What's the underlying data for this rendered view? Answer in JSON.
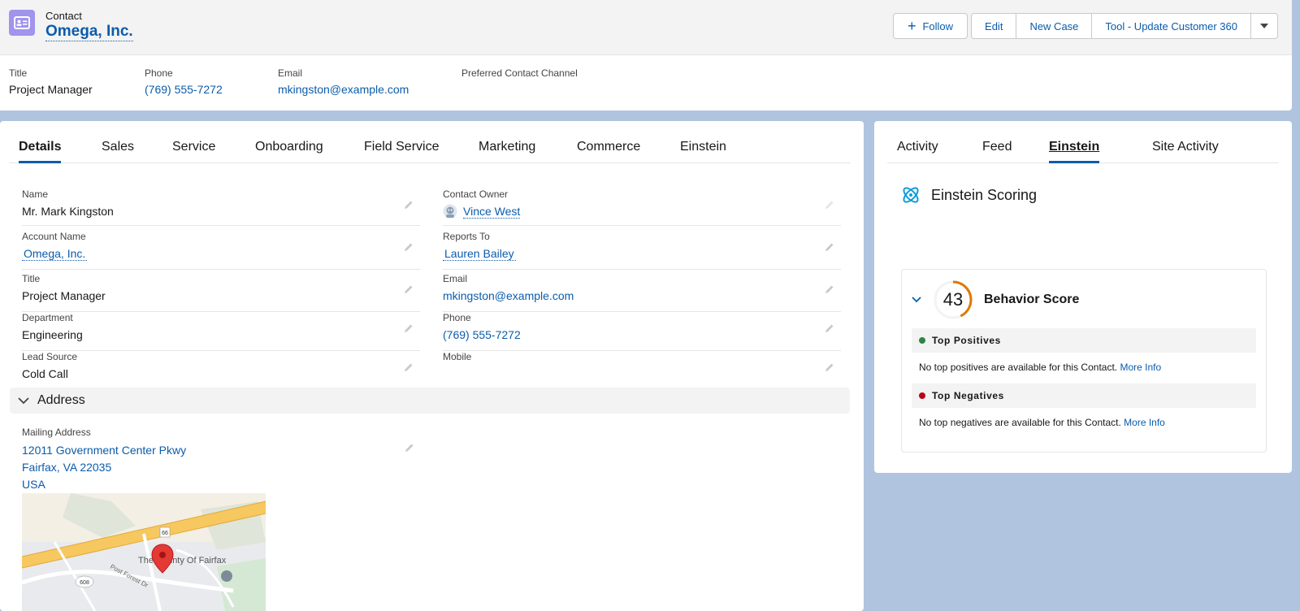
{
  "header": {
    "record_type": "Contact",
    "record_name": "Omega, Inc.",
    "actions": {
      "follow": "Follow",
      "edit": "Edit",
      "new_case": "New Case",
      "tool": "Tool - Update Customer 360"
    },
    "fields": [
      {
        "label": "Title",
        "value": "Project Manager"
      },
      {
        "label": "Phone",
        "value": "(769) 555-7272"
      },
      {
        "label": "Email",
        "value": "mkingston@example.com"
      },
      {
        "label": "Preferred Contact Channel",
        "value": ""
      }
    ]
  },
  "left_tabs": [
    "Details",
    "Sales",
    "Service",
    "Onboarding",
    "Field Service",
    "Marketing",
    "Commerce",
    "Einstein"
  ],
  "details": {
    "name": {
      "label": "Name",
      "value": "Mr. Mark Kingston"
    },
    "account_name": {
      "label": "Account Name",
      "value": "Omega, Inc."
    },
    "title": {
      "label": "Title",
      "value": "Project Manager"
    },
    "department": {
      "label": "Department",
      "value": "Engineering"
    },
    "lead_source": {
      "label": "Lead Source",
      "value": "Cold Call"
    },
    "contact_owner": {
      "label": "Contact Owner",
      "value": "Vince West"
    },
    "reports_to": {
      "label": "Reports To",
      "value": "Lauren Bailey"
    },
    "email": {
      "label": "Email",
      "value": "mkingston@example.com"
    },
    "phone": {
      "label": "Phone",
      "value": "(769) 555-7272"
    },
    "mobile": {
      "label": "Mobile",
      "value": ""
    }
  },
  "address_section": {
    "title": "Address",
    "mailing_label": "Mailing Address",
    "lines": [
      "12011 Government Center Pkwy",
      "Fairfax, VA 22035",
      "USA"
    ]
  },
  "map": {
    "labels": [
      "The County Of Fairfax",
      "Post Forest Dr",
      "66",
      "608"
    ]
  },
  "right_tabs": [
    "Activity",
    "Feed",
    "Einstein",
    "Site Activity"
  ],
  "einstein": {
    "title": "Einstein Scoring",
    "score": "43",
    "score_fraction": 0.43,
    "score_title": "Behavior Score",
    "positives_title": "Top Positives",
    "positives_text": "No top positives are available for this Contact.",
    "negatives_title": "Top Negatives",
    "negatives_text": "No top negatives are available for this Contact.",
    "more_info": "More Info"
  },
  "colors": {
    "brand": "#0b5cab",
    "contact_icon": "#a094ed",
    "score_ring": "#dd7a01",
    "positive": "#2e844a",
    "negative": "#ba0517",
    "background": "#b0c4df"
  }
}
